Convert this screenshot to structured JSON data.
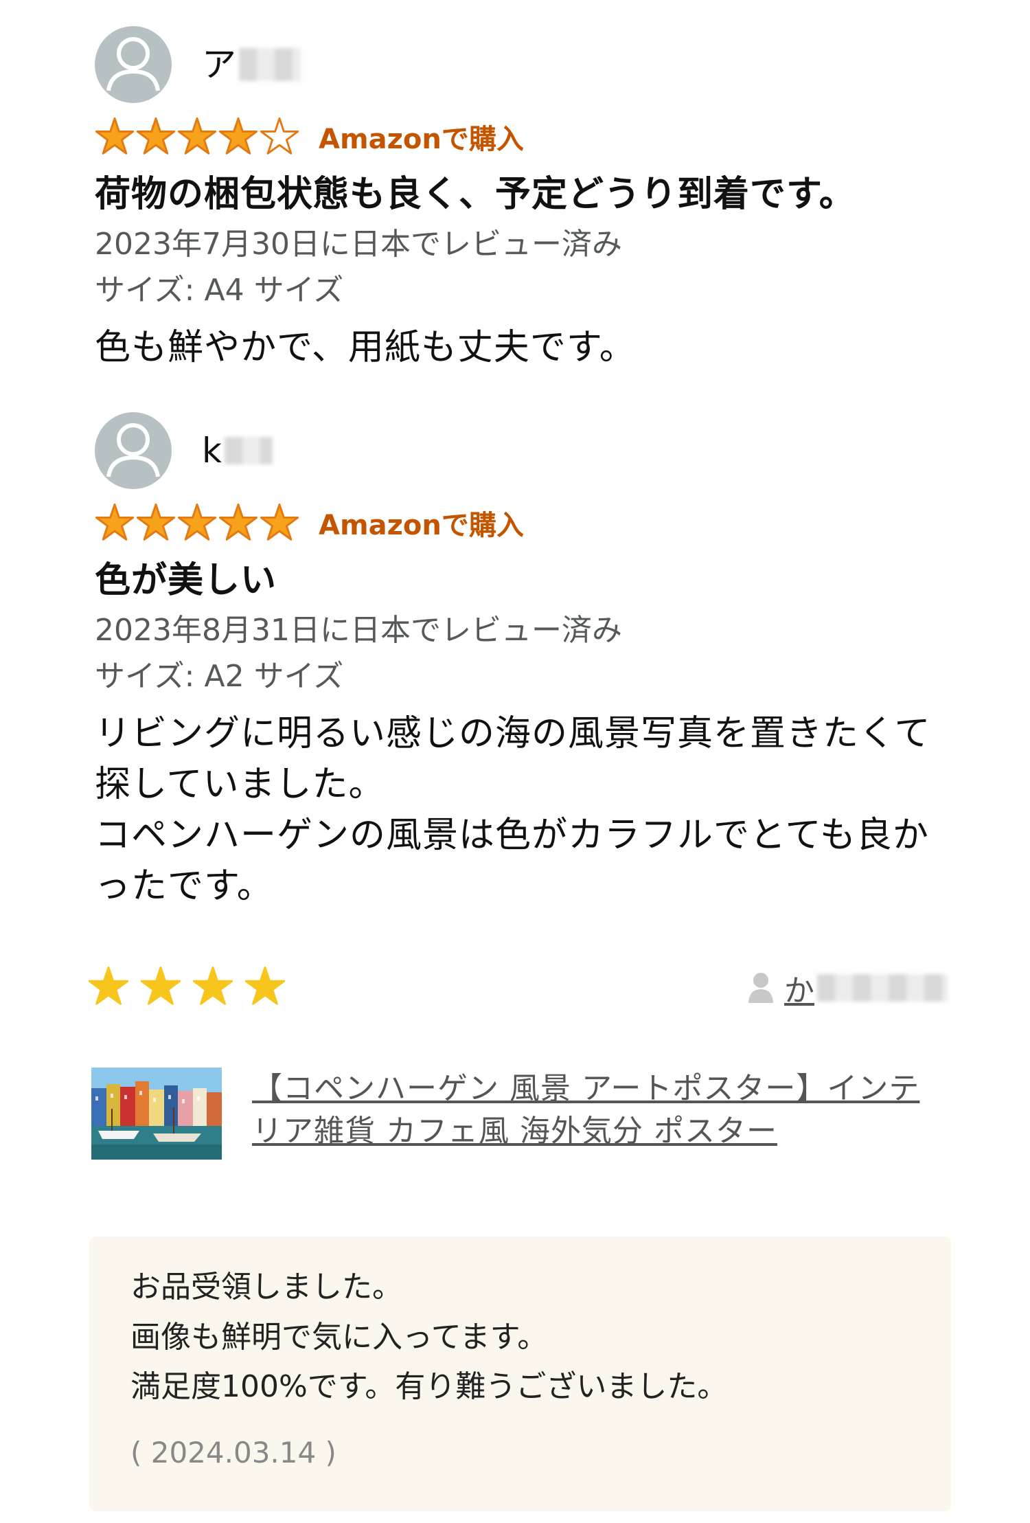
{
  "reviews": [
    {
      "reviewer": "ア",
      "rating": 4,
      "max_rating": 5,
      "verified_label": "Amazonで購入",
      "title": "荷物の梱包状態も良く、予定どうり到着です。",
      "date": "2023年7月30日に日本でレビュー済み",
      "variant": "サイズ: A4 サイズ",
      "body": "色も鮮やかで、用紙も丈夫です。"
    },
    {
      "reviewer": "k",
      "rating": 5,
      "max_rating": 5,
      "verified_label": "Amazonで購入",
      "title": "色が美しい",
      "date": "2023年8月31日に日本でレビュー済み",
      "variant": "サイズ: A2 サイズ",
      "body": "リビングに明るい感じの海の風景写真を置きたくて探していました。\nコペンハーゲンの風景は色がカラフルでとても良かったです。"
    }
  ],
  "rakuten_review": {
    "rating": 4,
    "reviewer": "か",
    "product_title": "【コペンハーゲン 風景 アートポスター】インテリア雑貨 カフェ風 海外気分 ポスター",
    "comment": "お品受領しました。\n画像も鮮明で気に入ってます。\n満足度100%です。有り難うございました。",
    "date": "( 2024.03.14 )"
  },
  "colors": {
    "amazon_star": "#f6a21a",
    "verified": "#c45500",
    "yellow_star": "#f7c61c",
    "comment_bg": "#fbf7ee"
  },
  "icons": {
    "avatar": "default-user-avatar",
    "star": "star-icon",
    "user": "user-icon",
    "thumbnail": "copenhagen-nyhavn-thumbnail"
  }
}
